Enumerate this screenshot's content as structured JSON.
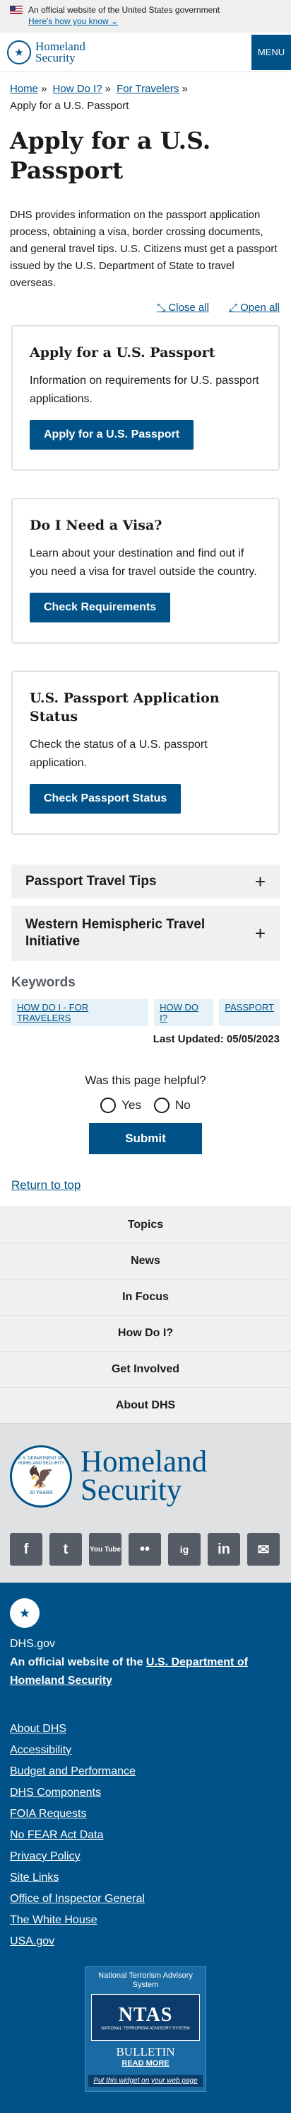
{
  "banner": {
    "official_text": "An official website of the United States government",
    "know_link": "Here's how you know"
  },
  "header": {
    "logo_line1": "Homeland",
    "logo_line2": "Security",
    "menu_label": "MENU"
  },
  "breadcrumb": {
    "items": [
      "Home",
      "How Do I?",
      "For Travelers"
    ],
    "separator": "»",
    "current": "Apply for a U.S. Passport"
  },
  "page": {
    "title": "Apply for a U.S. Passport",
    "intro": "DHS provides information on the passport application process, obtaining a visa, border crossing documents, and general travel tips. U.S. Citizens must get a passport issued by the U.S. Department of State to travel overseas.",
    "close_all": "Close all",
    "open_all": "Open all"
  },
  "cards": [
    {
      "title": "Apply for a U.S. Passport",
      "text": "Information on requirements for U.S. passport applications.",
      "button": "Apply for a U.S. Passport"
    },
    {
      "title": "Do I Need a Visa?",
      "text": "Learn about your destination and find out if you need a visa for travel outside the country.",
      "button": "Check Requirements"
    },
    {
      "title": "U.S. Passport Application Status",
      "text": "Check the status of a U.S. passport application.",
      "button": "Check Passport Status"
    }
  ],
  "accordion": [
    {
      "label": "Passport Travel Tips"
    },
    {
      "label": "Western Hemispheric Travel Initiative"
    }
  ],
  "keywords": {
    "heading": "Keywords",
    "tags": [
      "HOW DO I - FOR TRAVELERS",
      "HOW DO I?",
      "PASSPORT"
    ],
    "last_updated": "Last Updated: 05/05/2023"
  },
  "feedback": {
    "question": "Was this page helpful?",
    "yes": "Yes",
    "no": "No",
    "submit": "Submit"
  },
  "return_to_top": "Return to top",
  "footer_nav": [
    "Topics",
    "News",
    "In Focus",
    "How Do I?",
    "Get Involved",
    "About DHS"
  ],
  "footer_logo": {
    "seal_text": "U.S. DEPARTMENT OF HOMELAND SECURITY",
    "seal_years": "20 YEARS",
    "line1": "Homeland",
    "line2": "Security"
  },
  "social": [
    "f",
    "t",
    "You Tube",
    "••",
    "ig",
    "in",
    "✉"
  ],
  "footer_main": {
    "site": "DHS.gov",
    "official_prefix": "An official website of the ",
    "official_link": "U.S. Department of Homeland Security",
    "links": [
      "About DHS",
      "Accessibility",
      "Budget and Performance",
      "DHS Components",
      "FOIA Requests",
      "No FEAR Act Data",
      "Privacy Policy",
      "Site Links",
      "Office of Inspector General",
      "The White House",
      "USA.gov"
    ]
  },
  "ntas": {
    "title": "National Terrorism Advisory System",
    "logo": "NTAS",
    "sub": "NATIONAL TERRORISM ADVISORY SYSTEM",
    "bulletin": "BULLETIN",
    "read_more": "READ MORE",
    "widget": "Put this widget on your web page"
  }
}
